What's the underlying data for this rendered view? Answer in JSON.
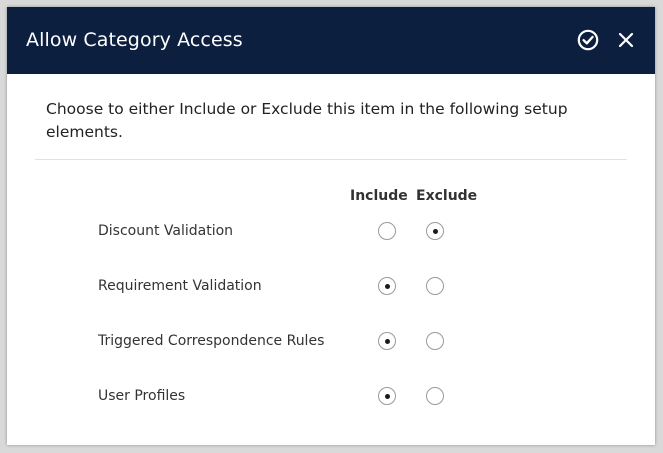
{
  "dialog": {
    "title": "Allow Category Access",
    "confirm_icon": "check-circle-icon",
    "close_icon": "close-icon",
    "header_color": "#0d1f3f"
  },
  "intro_text": "Choose to either Include or Exclude this item in the following setup elements.",
  "columns": {
    "include": "Include",
    "exclude": "Exclude"
  },
  "rows": [
    {
      "label": "Discount Validation",
      "selected": "exclude"
    },
    {
      "label": "Requirement Validation",
      "selected": "include"
    },
    {
      "label": "Triggered Correspondence Rules",
      "selected": "include"
    },
    {
      "label": "User Profiles",
      "selected": "include"
    }
  ]
}
